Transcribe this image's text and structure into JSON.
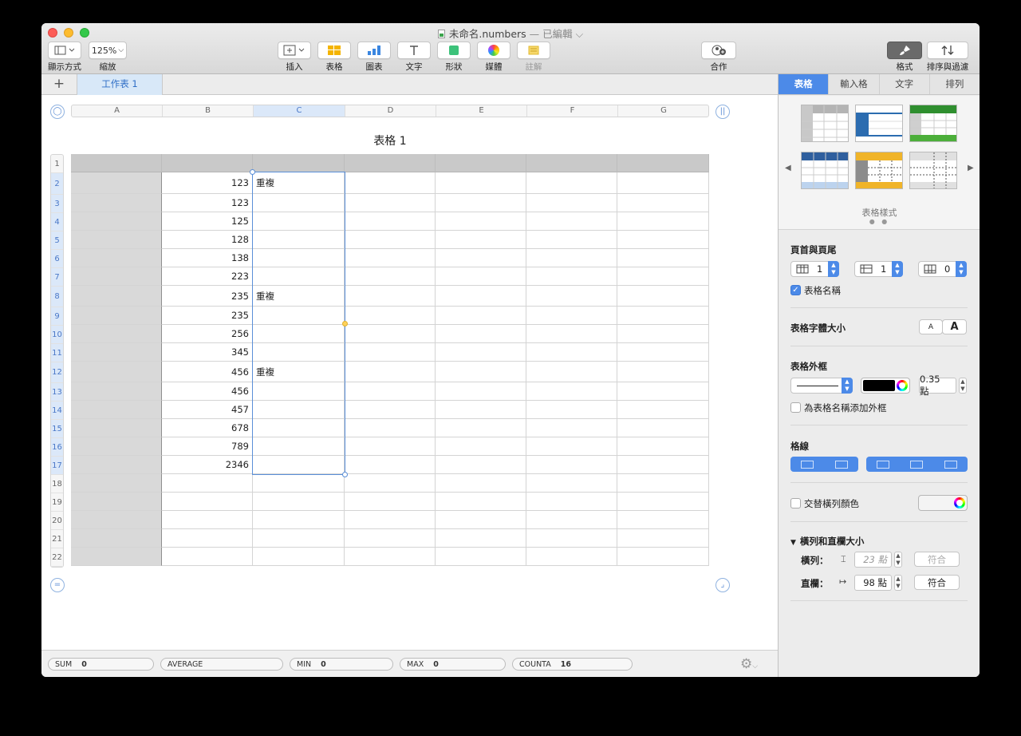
{
  "window": {
    "title": "未命名.numbers",
    "edited": "— 已編輯 ⌵"
  },
  "toolbar": {
    "view_label": "顯示方式",
    "zoom_value": "125%",
    "zoom_label": "縮放",
    "insert_label": "插入",
    "table_label": "表格",
    "chart_label": "圖表",
    "text_label": "文字",
    "shape_label": "形狀",
    "media_label": "媒體",
    "comment_label": "註解",
    "collaborate_label": "合作",
    "format_label": "格式",
    "sort_filter_label": "排序與過濾"
  },
  "sheets": {
    "add": "+",
    "tabs": [
      "工作表 1"
    ]
  },
  "table": {
    "title": "表格 1",
    "columns": [
      "A",
      "B",
      "C",
      "D",
      "E",
      "F",
      "G"
    ],
    "rows": [
      "1",
      "2",
      "3",
      "4",
      "5",
      "6",
      "7",
      "8",
      "9",
      "10",
      "11",
      "12",
      "13",
      "14",
      "15",
      "16",
      "17",
      "18",
      "19",
      "20",
      "21",
      "22"
    ],
    "b_values": [
      "",
      "123",
      "123",
      "125",
      "128",
      "138",
      "223",
      "235",
      "235",
      "256",
      "345",
      "456",
      "456",
      "457",
      "678",
      "789",
      "2346",
      "",
      "",
      "",
      "",
      ""
    ],
    "c_values": [
      "",
      "重複",
      "",
      "",
      "",
      "",
      "",
      "重複",
      "",
      "",
      "",
      "重複",
      "",
      "",
      "",
      "",
      "",
      "",
      "",
      "",
      "",
      ""
    ]
  },
  "status": {
    "sum_label": "SUM",
    "sum_value": "0",
    "average_label": "AVERAGE",
    "min_label": "MIN",
    "min_value": "0",
    "max_label": "MAX",
    "max_value": "0",
    "counta_label": "COUNTA",
    "counta_value": "16"
  },
  "inspector": {
    "tabs": [
      "表格",
      "輸入格",
      "文字",
      "排列"
    ],
    "styles_caption": "表格樣式",
    "header_footer_title": "頁首與頁尾",
    "header_rows": "1",
    "header_cols": "1",
    "footer_rows": "0",
    "table_name_label": "表格名稱",
    "font_size_title": "表格字體大小",
    "font_small": "A",
    "font_large": "A",
    "outline_title": "表格外框",
    "outline_width": "0.35 點",
    "outline_name_label": "為表格名稱添加外框",
    "gridlines_title": "格線",
    "alternate_label": "交替橫列顏色",
    "rowcol_title": "橫列和直欄大小",
    "row_label": "橫列：",
    "row_height": "23 點",
    "col_label": "直欄：",
    "col_width": "98 點",
    "fit_label": "符合",
    "fit_label_2": "符合"
  },
  "colors": {
    "accent": "#4c8ae8",
    "selection": "#5a8fd8",
    "header_fill": "#c9c9c9",
    "header_col_fill": "#d9d9d9"
  }
}
